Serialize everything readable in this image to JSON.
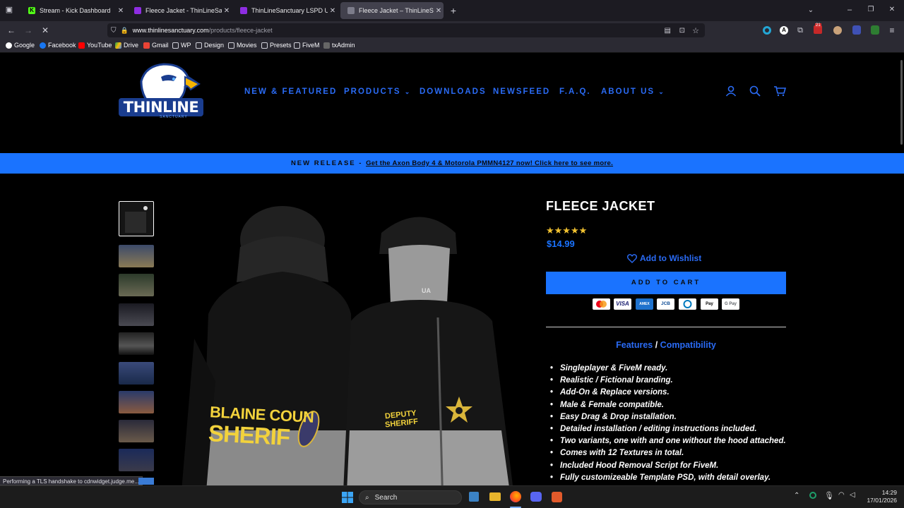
{
  "browser": {
    "tabs": [
      {
        "title": "Stream - Kick Dashboard",
        "color": "#53fc18"
      },
      {
        "title": "Fleece Jacket - ThinLineSanctuary",
        "color": "#8e2de2"
      },
      {
        "title": "ThinLineSanctuary LSPD Uniform",
        "color": "#8e2de2"
      },
      {
        "title": "Fleece Jacket – ThinLineSanctuary",
        "color": "#7c7c8a"
      }
    ],
    "url_host": "www.thinlinesanctuary.com",
    "url_path": "/products/fleece-jacket",
    "bookmarks": [
      {
        "label": "Google",
        "icon": "google-icon"
      },
      {
        "label": "Facebook",
        "icon": "facebook-icon"
      },
      {
        "label": "YouTube",
        "icon": "youtube-icon"
      },
      {
        "label": "Drive",
        "icon": "drive-icon"
      },
      {
        "label": "Gmail",
        "icon": "gmail-icon"
      },
      {
        "label": "WP",
        "icon": "folder-icon"
      },
      {
        "label": "Design",
        "icon": "folder-icon"
      },
      {
        "label": "Movies",
        "icon": "folder-icon"
      },
      {
        "label": "Presets",
        "icon": "folder-icon"
      },
      {
        "label": "FiveM",
        "icon": "folder-icon"
      },
      {
        "label": "txAdmin",
        "icon": "txadmin-icon"
      }
    ],
    "extension_badge": "21",
    "status_text": "Performing a TLS handshake to cdnwidget.judge.me..."
  },
  "site": {
    "logo_text": "THINLINE",
    "logo_sub": "SANCTUARY",
    "nav": [
      {
        "label": "NEW & FEATURED",
        "has_dropdown": false
      },
      {
        "label": "PRODUCTS",
        "has_dropdown": true
      },
      {
        "label": "DOWNLOADS",
        "has_dropdown": false
      },
      {
        "label": "NEWSFEED",
        "has_dropdown": false
      },
      {
        "label": "F.A.Q.",
        "has_dropdown": false
      },
      {
        "label": "ABOUT US",
        "has_dropdown": true
      }
    ],
    "announcement_prefix": "NEW RELEASE - ",
    "announcement_link": "Get the Axon Body 4 & Motorola PMMN4127 now! Click here to see more.",
    "image_text_left_1": "BLAINE COUN",
    "image_text_left_2": "SHERIF",
    "image_text_right_1": "DEPUTY",
    "image_text_right_2": "SHERIFF",
    "image_text_cap": "UA"
  },
  "product": {
    "title": "FLEECE JACKET",
    "rating": 5,
    "price": "$14.99",
    "wishlist": "Add to Wishlist",
    "add_to_cart": "ADD TO CART",
    "payments": [
      "mastercard-icon",
      "visa-icon",
      "amex-icon",
      "jcb-icon",
      "diners-icon",
      "applepay-icon",
      "googlepay-icon"
    ],
    "tab_features": "Features",
    "tab_separator": " / ",
    "tab_compat": "Compatibility",
    "features": [
      "Singleplayer & FiveM ready.",
      "Realistic / Fictional branding.",
      "Add-On & Replace versions.",
      "Male & Female compatible.",
      "Easy Drag & Drop installation.",
      "Detailed installation / editing instructions included.",
      "Two variants, one with and one without the hood attached.",
      "Comes with 12 Textures in total.",
      "Included Hood Removal Script for FiveM.",
      "Fully customizeable Template PSD, with detail overlay."
    ]
  },
  "taskbar": {
    "search": "Search",
    "time": "14:29",
    "date": "17/01/2026"
  }
}
